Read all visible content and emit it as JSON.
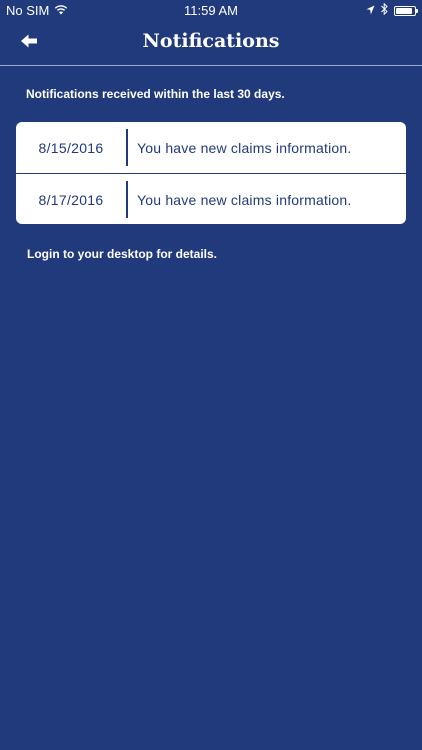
{
  "status_bar": {
    "carrier": "No SIM",
    "time": "11:59 AM",
    "battery_level": 0.9
  },
  "nav": {
    "title": "Notifications",
    "back_icon": "back-arrow-icon"
  },
  "content": {
    "subtitle": "Notifications received within the last 30 days.",
    "notifications": [
      {
        "date": "8/15/2016",
        "message": "You have new claims information."
      },
      {
        "date": "8/17/2016",
        "message": "You have new claims information."
      }
    ],
    "footer_note": "Login to your desktop for details."
  },
  "colors": {
    "background": "#213a7c",
    "card": "#ffffff",
    "text_on_card": "#213a7c"
  }
}
